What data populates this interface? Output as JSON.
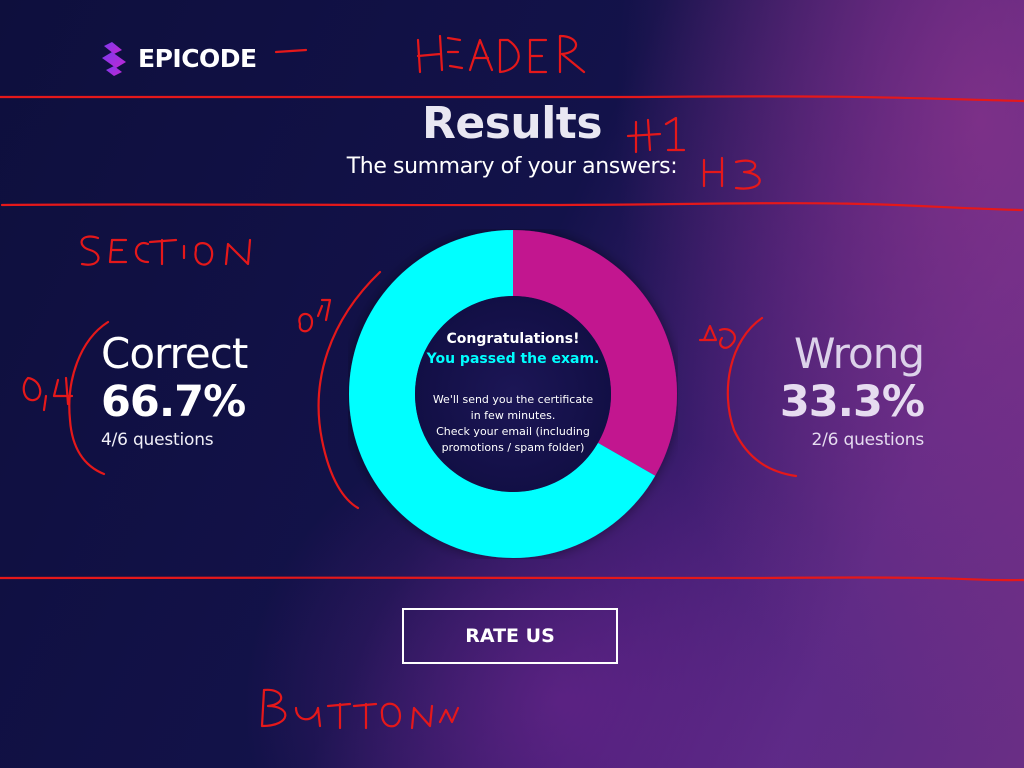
{
  "brand": {
    "name": "EPICODE",
    "logo_icon": "epicode-logo-icon",
    "logo_colors": [
      "#7c3aed",
      "#c026d3"
    ]
  },
  "header": {
    "title": "Results",
    "subtitle": "The summary of your answers:"
  },
  "stats": {
    "correct": {
      "label": "Correct",
      "percent": "66.7%",
      "questions": "4/6 questions"
    },
    "wrong": {
      "label": "Wrong",
      "percent": "33.3%",
      "questions": "2/6 questions"
    }
  },
  "chart_data": {
    "type": "pie",
    "categories": [
      "Correct",
      "Wrong"
    ],
    "values": [
      66.7,
      33.3
    ],
    "colors": [
      "#00ffff",
      "#c2128f"
    ],
    "title": "",
    "style": "donut"
  },
  "donut_center": {
    "title": "Congratulations!",
    "passed": "You passed the exam.",
    "body_lines": [
      "We'll send you the certificate",
      "in few minutes.",
      "Check your email (including",
      "promotions / spam folder)"
    ]
  },
  "actions": {
    "rate_label": "RATE US"
  },
  "colors": {
    "accent_cyan": "#00ffff",
    "accent_magenta": "#c2128f",
    "annotation_red": "#e5181a"
  }
}
